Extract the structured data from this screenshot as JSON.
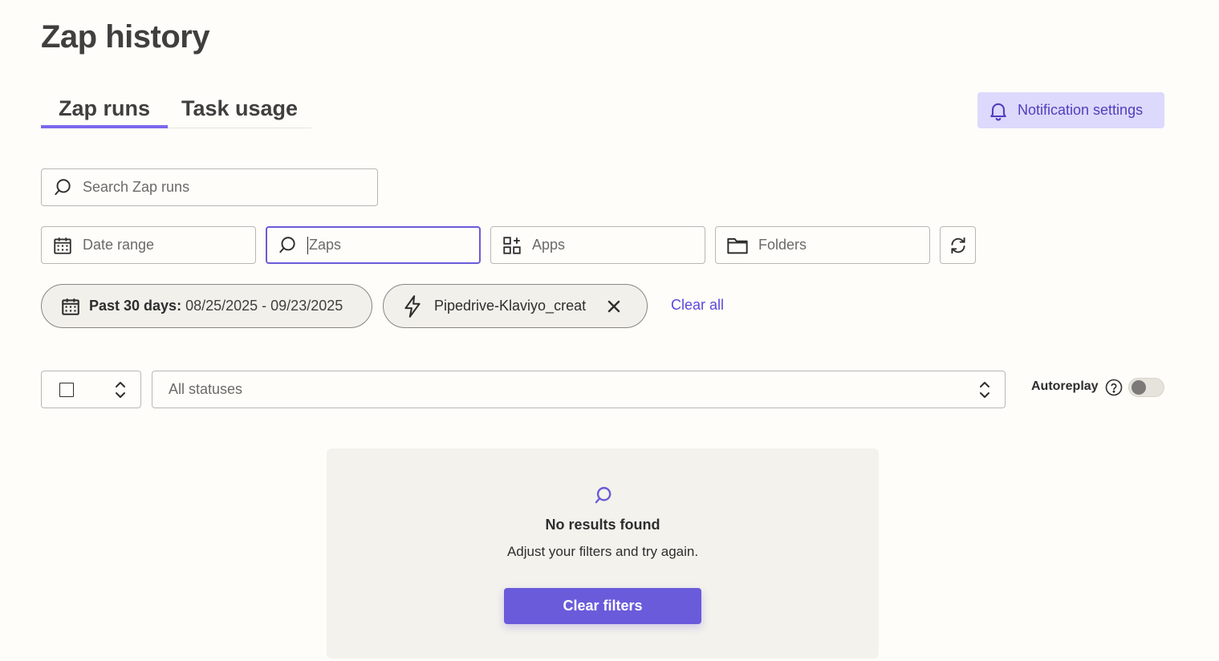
{
  "page": {
    "title": "Zap history"
  },
  "tabs": [
    {
      "label": "Zap runs",
      "active": true
    },
    {
      "label": "Task usage",
      "active": false
    }
  ],
  "notification_button": {
    "label": "Notification settings",
    "icon": "bell-icon"
  },
  "search": {
    "placeholder": "Search Zap runs",
    "icon": "search-icon"
  },
  "filters": {
    "date_range": {
      "placeholder": "Date range",
      "icon": "calendar-icon"
    },
    "zaps": {
      "placeholder": "Zaps",
      "icon": "search-icon",
      "focused": true
    },
    "apps": {
      "placeholder": "Apps",
      "icon": "apps-grid-icon"
    },
    "folders": {
      "placeholder": "Folders",
      "icon": "folder-icon"
    },
    "refresh_icon": "refresh-icon"
  },
  "active_filters": {
    "date_chip": {
      "bold_label": "Past 30 days:",
      "value": "08/25/2025 - 09/23/2025",
      "icon": "calendar-icon"
    },
    "zap_chip": {
      "label": "Pipedrive-Klaviyo_creat",
      "icon": "lightning-icon",
      "remove_icon": "close-icon"
    },
    "clear_all": "Clear all"
  },
  "list_controls": {
    "status_select": "All statuses",
    "autoreplay_label": "Autoreplay",
    "autoreplay_enabled": false
  },
  "empty_state": {
    "title": "No results found",
    "message": "Adjust your filters and try again.",
    "button": "Clear filters"
  },
  "colors": {
    "accent": "#6a5bdb",
    "background": "#fffdf9",
    "card": "#f3f2ec"
  }
}
